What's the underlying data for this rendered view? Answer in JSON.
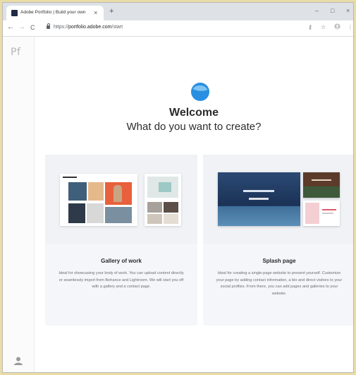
{
  "browser": {
    "tab_title": "Adobe Portfolio | Build your own",
    "tab_close": "×",
    "new_tab": "+",
    "window_controls": {
      "minimize": "–",
      "maximize": "□",
      "close": "×"
    },
    "nav": {
      "back": "←",
      "forward": "→",
      "reload": "C"
    },
    "url_scheme": "https://",
    "url_host": "portfolio.adobe.com",
    "url_path": "/start",
    "toolbar_icons": [
      "key-icon",
      "star-icon",
      "account-icon",
      "menu-icon"
    ]
  },
  "sidebar": {
    "logo": "Pf"
  },
  "main": {
    "title": "Welcome",
    "subtitle": "What do you want to create?",
    "cards": [
      {
        "title": "Gallery of work",
        "description": "Ideal for showcasing your body of work. You can upload content directly or seamlessly import from Behance and Lightroom. We will start you off with a gallery and a contact page."
      },
      {
        "title": "Splash page",
        "description": "Ideal for creating a single-page website to present yourself. Customize your page by adding contact information, a bio and direct visitors to your social profiles. From there, you can add pages and galleries to your website."
      }
    ]
  },
  "colors": {
    "brand_blue": "#2a8fe0",
    "brand_light_blue": "#7fc4f2",
    "card_bg": "#f4f6f9",
    "desktop_bg": "#e9dca6"
  }
}
